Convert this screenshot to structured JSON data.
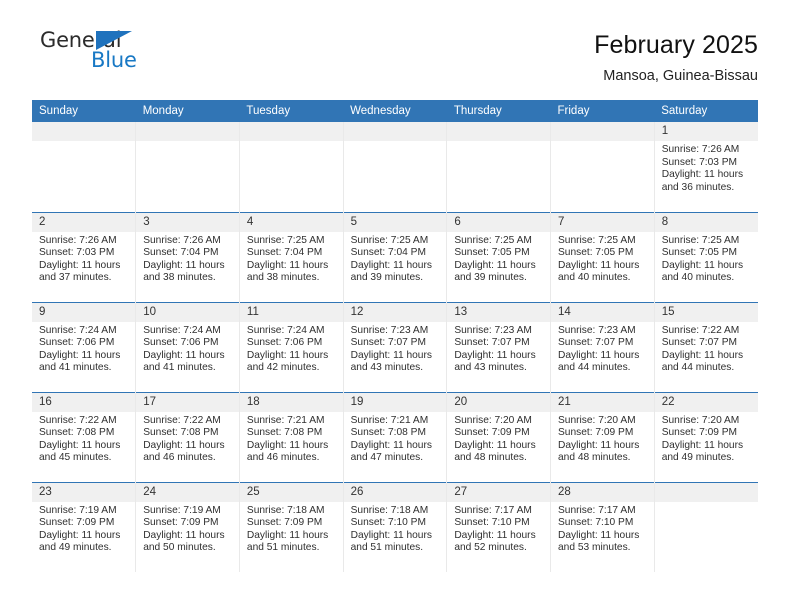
{
  "logo": {
    "word_one": "General",
    "word_two": "Blue",
    "triangle_color": "#1f72bd",
    "blue_text_color": "#1878c4"
  },
  "header": {
    "title": "February 2025",
    "subtitle": "Mansoa, Guinea-Bissau"
  },
  "theme": {
    "header_blue": "#3175b5",
    "daynum_bg": "#f0f0f0",
    "cell_border": "#e9e9e9"
  },
  "weekday_headers": [
    "Sunday",
    "Monday",
    "Tuesday",
    "Wednesday",
    "Thursday",
    "Friday",
    "Saturday"
  ],
  "labels": {
    "sunrise_prefix": "Sunrise:",
    "sunset_prefix": "Sunset:",
    "daylight_prefix": "Daylight:"
  },
  "weeks": [
    [
      {
        "day": "",
        "sunrise": "",
        "sunset": "",
        "daylight_line1": "",
        "daylight_line2": ""
      },
      {
        "day": "",
        "sunrise": "",
        "sunset": "",
        "daylight_line1": "",
        "daylight_line2": ""
      },
      {
        "day": "",
        "sunrise": "",
        "sunset": "",
        "daylight_line1": "",
        "daylight_line2": ""
      },
      {
        "day": "",
        "sunrise": "",
        "sunset": "",
        "daylight_line1": "",
        "daylight_line2": ""
      },
      {
        "day": "",
        "sunrise": "",
        "sunset": "",
        "daylight_line1": "",
        "daylight_line2": ""
      },
      {
        "day": "",
        "sunrise": "",
        "sunset": "",
        "daylight_line1": "",
        "daylight_line2": ""
      },
      {
        "day": "1",
        "sunrise": "Sunrise: 7:26 AM",
        "sunset": "Sunset: 7:03 PM",
        "daylight_line1": "Daylight: 11 hours",
        "daylight_line2": "and 36 minutes."
      }
    ],
    [
      {
        "day": "2",
        "sunrise": "Sunrise: 7:26 AM",
        "sunset": "Sunset: 7:03 PM",
        "daylight_line1": "Daylight: 11 hours",
        "daylight_line2": "and 37 minutes."
      },
      {
        "day": "3",
        "sunrise": "Sunrise: 7:26 AM",
        "sunset": "Sunset: 7:04 PM",
        "daylight_line1": "Daylight: 11 hours",
        "daylight_line2": "and 38 minutes."
      },
      {
        "day": "4",
        "sunrise": "Sunrise: 7:25 AM",
        "sunset": "Sunset: 7:04 PM",
        "daylight_line1": "Daylight: 11 hours",
        "daylight_line2": "and 38 minutes."
      },
      {
        "day": "5",
        "sunrise": "Sunrise: 7:25 AM",
        "sunset": "Sunset: 7:04 PM",
        "daylight_line1": "Daylight: 11 hours",
        "daylight_line2": "and 39 minutes."
      },
      {
        "day": "6",
        "sunrise": "Sunrise: 7:25 AM",
        "sunset": "Sunset: 7:05 PM",
        "daylight_line1": "Daylight: 11 hours",
        "daylight_line2": "and 39 minutes."
      },
      {
        "day": "7",
        "sunrise": "Sunrise: 7:25 AM",
        "sunset": "Sunset: 7:05 PM",
        "daylight_line1": "Daylight: 11 hours",
        "daylight_line2": "and 40 minutes."
      },
      {
        "day": "8",
        "sunrise": "Sunrise: 7:25 AM",
        "sunset": "Sunset: 7:05 PM",
        "daylight_line1": "Daylight: 11 hours",
        "daylight_line2": "and 40 minutes."
      }
    ],
    [
      {
        "day": "9",
        "sunrise": "Sunrise: 7:24 AM",
        "sunset": "Sunset: 7:06 PM",
        "daylight_line1": "Daylight: 11 hours",
        "daylight_line2": "and 41 minutes."
      },
      {
        "day": "10",
        "sunrise": "Sunrise: 7:24 AM",
        "sunset": "Sunset: 7:06 PM",
        "daylight_line1": "Daylight: 11 hours",
        "daylight_line2": "and 41 minutes."
      },
      {
        "day": "11",
        "sunrise": "Sunrise: 7:24 AM",
        "sunset": "Sunset: 7:06 PM",
        "daylight_line1": "Daylight: 11 hours",
        "daylight_line2": "and 42 minutes."
      },
      {
        "day": "12",
        "sunrise": "Sunrise: 7:23 AM",
        "sunset": "Sunset: 7:07 PM",
        "daylight_line1": "Daylight: 11 hours",
        "daylight_line2": "and 43 minutes."
      },
      {
        "day": "13",
        "sunrise": "Sunrise: 7:23 AM",
        "sunset": "Sunset: 7:07 PM",
        "daylight_line1": "Daylight: 11 hours",
        "daylight_line2": "and 43 minutes."
      },
      {
        "day": "14",
        "sunrise": "Sunrise: 7:23 AM",
        "sunset": "Sunset: 7:07 PM",
        "daylight_line1": "Daylight: 11 hours",
        "daylight_line2": "and 44 minutes."
      },
      {
        "day": "15",
        "sunrise": "Sunrise: 7:22 AM",
        "sunset": "Sunset: 7:07 PM",
        "daylight_line1": "Daylight: 11 hours",
        "daylight_line2": "and 44 minutes."
      }
    ],
    [
      {
        "day": "16",
        "sunrise": "Sunrise: 7:22 AM",
        "sunset": "Sunset: 7:08 PM",
        "daylight_line1": "Daylight: 11 hours",
        "daylight_line2": "and 45 minutes."
      },
      {
        "day": "17",
        "sunrise": "Sunrise: 7:22 AM",
        "sunset": "Sunset: 7:08 PM",
        "daylight_line1": "Daylight: 11 hours",
        "daylight_line2": "and 46 minutes."
      },
      {
        "day": "18",
        "sunrise": "Sunrise: 7:21 AM",
        "sunset": "Sunset: 7:08 PM",
        "daylight_line1": "Daylight: 11 hours",
        "daylight_line2": "and 46 minutes."
      },
      {
        "day": "19",
        "sunrise": "Sunrise: 7:21 AM",
        "sunset": "Sunset: 7:08 PM",
        "daylight_line1": "Daylight: 11 hours",
        "daylight_line2": "and 47 minutes."
      },
      {
        "day": "20",
        "sunrise": "Sunrise: 7:20 AM",
        "sunset": "Sunset: 7:09 PM",
        "daylight_line1": "Daylight: 11 hours",
        "daylight_line2": "and 48 minutes."
      },
      {
        "day": "21",
        "sunrise": "Sunrise: 7:20 AM",
        "sunset": "Sunset: 7:09 PM",
        "daylight_line1": "Daylight: 11 hours",
        "daylight_line2": "and 48 minutes."
      },
      {
        "day": "22",
        "sunrise": "Sunrise: 7:20 AM",
        "sunset": "Sunset: 7:09 PM",
        "daylight_line1": "Daylight: 11 hours",
        "daylight_line2": "and 49 minutes."
      }
    ],
    [
      {
        "day": "23",
        "sunrise": "Sunrise: 7:19 AM",
        "sunset": "Sunset: 7:09 PM",
        "daylight_line1": "Daylight: 11 hours",
        "daylight_line2": "and 49 minutes."
      },
      {
        "day": "24",
        "sunrise": "Sunrise: 7:19 AM",
        "sunset": "Sunset: 7:09 PM",
        "daylight_line1": "Daylight: 11 hours",
        "daylight_line2": "and 50 minutes."
      },
      {
        "day": "25",
        "sunrise": "Sunrise: 7:18 AM",
        "sunset": "Sunset: 7:09 PM",
        "daylight_line1": "Daylight: 11 hours",
        "daylight_line2": "and 51 minutes."
      },
      {
        "day": "26",
        "sunrise": "Sunrise: 7:18 AM",
        "sunset": "Sunset: 7:10 PM",
        "daylight_line1": "Daylight: 11 hours",
        "daylight_line2": "and 51 minutes."
      },
      {
        "day": "27",
        "sunrise": "Sunrise: 7:17 AM",
        "sunset": "Sunset: 7:10 PM",
        "daylight_line1": "Daylight: 11 hours",
        "daylight_line2": "and 52 minutes."
      },
      {
        "day": "28",
        "sunrise": "Sunrise: 7:17 AM",
        "sunset": "Sunset: 7:10 PM",
        "daylight_line1": "Daylight: 11 hours",
        "daylight_line2": "and 53 minutes."
      },
      {
        "day": "",
        "sunrise": "",
        "sunset": "",
        "daylight_line1": "",
        "daylight_line2": ""
      }
    ]
  ]
}
